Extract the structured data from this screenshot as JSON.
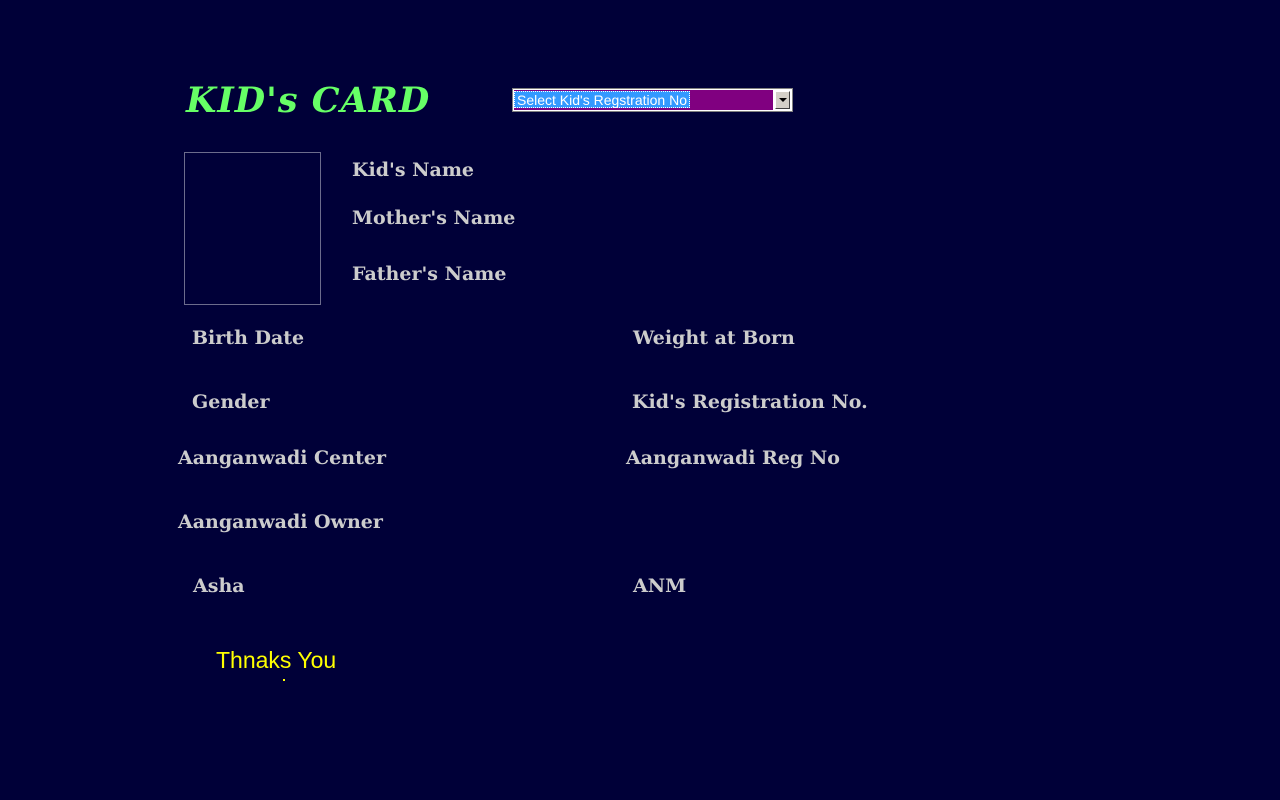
{
  "header": {
    "title": "KID's CARD"
  },
  "registration_select": {
    "selected_label": "Select Kid's Regstration No",
    "highlight_color": "#3399ff",
    "background_color": "#800080"
  },
  "labels": {
    "kids_name": "Kid's Name",
    "mothers_name": "Mother's Name",
    "fathers_name": "Father's Name",
    "birth_date": "Birth Date",
    "weight_at_born": "Weight at Born",
    "gender": "Gender",
    "kids_registration_no": "Kid's Registration No.",
    "aanganwadi_center": "Aanganwadi Center",
    "aanganwadi_reg_no": "Aanganwadi Reg No",
    "aanganwadi_owner": "Aanganwadi Owner",
    "asha": "Asha",
    "anm": "ANM"
  },
  "footer": {
    "thanks_text": "Thnaks You"
  },
  "colors": {
    "background": "#000038",
    "title": "#66ff66",
    "label": "#cccccc",
    "thanks": "#ffff00"
  }
}
